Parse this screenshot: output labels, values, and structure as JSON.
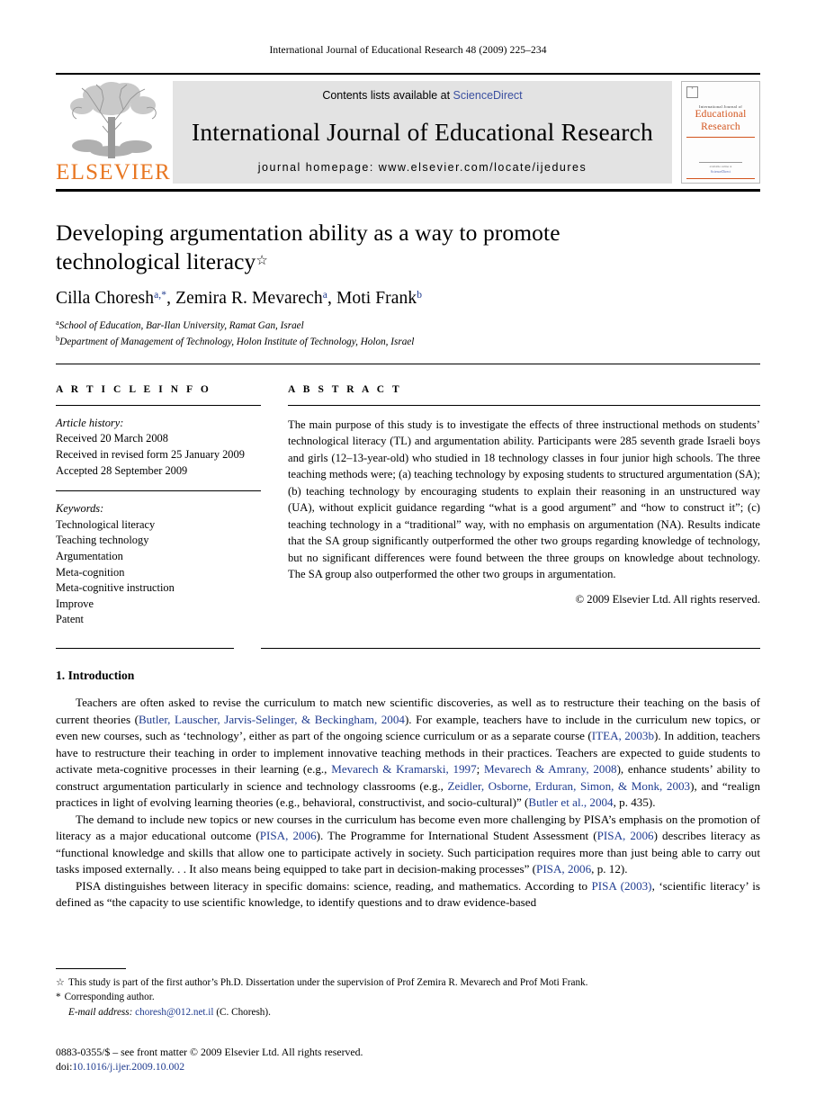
{
  "running_head": "International Journal of Educational Research 48 (2009) 225–234",
  "masthead": {
    "publisher_name": "ELSEVIER",
    "contents_prefix": "Contents lists available at ",
    "contents_link": "ScienceDirect",
    "journal_title": "International Journal of Educational Research",
    "homepage": "journal homepage: www.elsevier.com/locate/ijedures",
    "cover": {
      "supertitle": "International Journal of",
      "line1": "Educational",
      "line2": "Research",
      "footer_line": "available online at",
      "footer_mark": "ScienceDirect"
    },
    "link_color": "#3a4fa0",
    "brand_color": "#E87722",
    "cover_color": "#d2541d"
  },
  "article": {
    "title_line1": "Developing argumentation ability as a way to promote",
    "title_line2": "technological literacy",
    "title_marker": "☆",
    "authors": [
      {
        "name": "Cilla Choresh",
        "sup": "a,*"
      },
      {
        "name": "Zemira R. Mevarech",
        "sup": "a"
      },
      {
        "name": "Moti Frank",
        "sup": "b"
      }
    ],
    "affiliations": [
      {
        "mark": "a",
        "text": "School of Education, Bar-Ilan University, Ramat Gan, Israel"
      },
      {
        "mark": "b",
        "text": "Department of Management of Technology, Holon Institute of Technology, Holon, Israel"
      }
    ]
  },
  "article_info": {
    "heading": "A R T I C L E  I N F O",
    "history_label": "Article history:",
    "history": [
      "Received 20 March 2008",
      "Received in revised form 25 January 2009",
      "Accepted 28 September 2009"
    ],
    "keywords_label": "Keywords:",
    "keywords": [
      "Technological literacy",
      "Teaching technology",
      "Argumentation",
      "Meta-cognition",
      "Meta-cognitive instruction",
      "Improve",
      "Patent"
    ]
  },
  "abstract": {
    "heading": "A B S T R A C T",
    "text": "The main purpose of this study is to investigate the effects of three instructional methods on students’ technological literacy (TL) and argumentation ability. Participants were 285 seventh grade Israeli boys and girls (12–13-year-old) who studied in 18 technology classes in four junior high schools. The three teaching methods were; (a) teaching technology by exposing students to structured argumentation (SA); (b) teaching technology by encouraging students to explain their reasoning in an unstructured way (UA), without explicit guidance regarding “what is a good argument” and “how to construct it”; (c) teaching technology in a “traditional” way, with no emphasis on argumentation (NA). Results indicate that the SA group significantly outperformed the other two groups regarding knowledge of technology, but no significant differences were found between the three groups on knowledge about technology. The SA group also outperformed the other two groups in argumentation.",
    "copyright": "© 2009 Elsevier Ltd. All rights reserved."
  },
  "section": {
    "number_title": "1. Introduction",
    "paragraphs": [
      {
        "runs": [
          {
            "t": "Teachers are often asked to revise the curriculum to match new scientific discoveries, as well as to restructure their teaching on the basis of current theories ("
          },
          {
            "t": "Butler, Lauscher, Jarvis-Selinger, & Beckingham, 2004",
            "cit": true
          },
          {
            "t": "). For example, teachers have to include in the curriculum new topics, or even new courses, such as ‘technology’, either as part of the ongoing science curriculum or as a separate course ("
          },
          {
            "t": "ITEA, 2003b",
            "cit": true
          },
          {
            "t": "). In addition, teachers have to restructure their teaching in order to implement innovative teaching methods in their practices. Teachers are expected to guide students to activate meta-cognitive processes in their learning (e.g., "
          },
          {
            "t": "Mevarech & Kramarski, 1997",
            "cit": true
          },
          {
            "t": "; "
          },
          {
            "t": "Mevarech & Amrany, 2008",
            "cit": true
          },
          {
            "t": "), enhance students’ ability to construct argumentation particularly in science and technology classrooms (e.g., "
          },
          {
            "t": "Zeidler, Osborne, Erduran, Simon, & Monk, 2003",
            "cit": true
          },
          {
            "t": "), and “realign practices in light of evolving learning theories (e.g., behavioral, constructivist, and socio-cultural)” ("
          },
          {
            "t": "Butler et al., 2004",
            "cit": true
          },
          {
            "t": ", p. 435)."
          }
        ]
      },
      {
        "runs": [
          {
            "t": "The demand to include new topics or new courses in the curriculum has become even more challenging by PISA’s emphasis on the promotion of literacy as a major educational outcome ("
          },
          {
            "t": "PISA, 2006",
            "cit": true
          },
          {
            "t": "). The Programme for International Student Assessment ("
          },
          {
            "t": "PISA, 2006",
            "cit": true
          },
          {
            "t": ") describes literacy as “functional knowledge and skills that allow one to participate actively in society. Such participation requires more than just being able to carry out tasks imposed externally. . . It also means being equipped to take part in decision-making processes” ("
          },
          {
            "t": "PISA, 2006",
            "cit": true
          },
          {
            "t": ", p. 12)."
          }
        ]
      },
      {
        "runs": [
          {
            "t": "PISA distinguishes between literacy in specific domains: science, reading, and mathematics. According to "
          },
          {
            "t": "PISA (2003)",
            "cit": true
          },
          {
            "t": ", ‘scientific literacy’ is defined as “the capacity to use scientific knowledge, to identify questions and to draw evidence-based"
          }
        ]
      }
    ]
  },
  "footnotes": {
    "star_mark": "☆",
    "star_text": "This study is part of the first author’s Ph.D. Dissertation under the supervision of Prof Zemira R. Mevarech and Prof Moti Frank.",
    "corresponding_mark": "*",
    "corresponding_text": "Corresponding author.",
    "email_label": "E-mail address:",
    "email": "choresh@012.net.il",
    "email_owner": "(C. Choresh)."
  },
  "imprint": {
    "line1": "0883-0355/$ – see front matter © 2009 Elsevier Ltd. All rights reserved.",
    "doi_prefix": "doi:",
    "doi": "10.1016/j.ijer.2009.10.002"
  }
}
